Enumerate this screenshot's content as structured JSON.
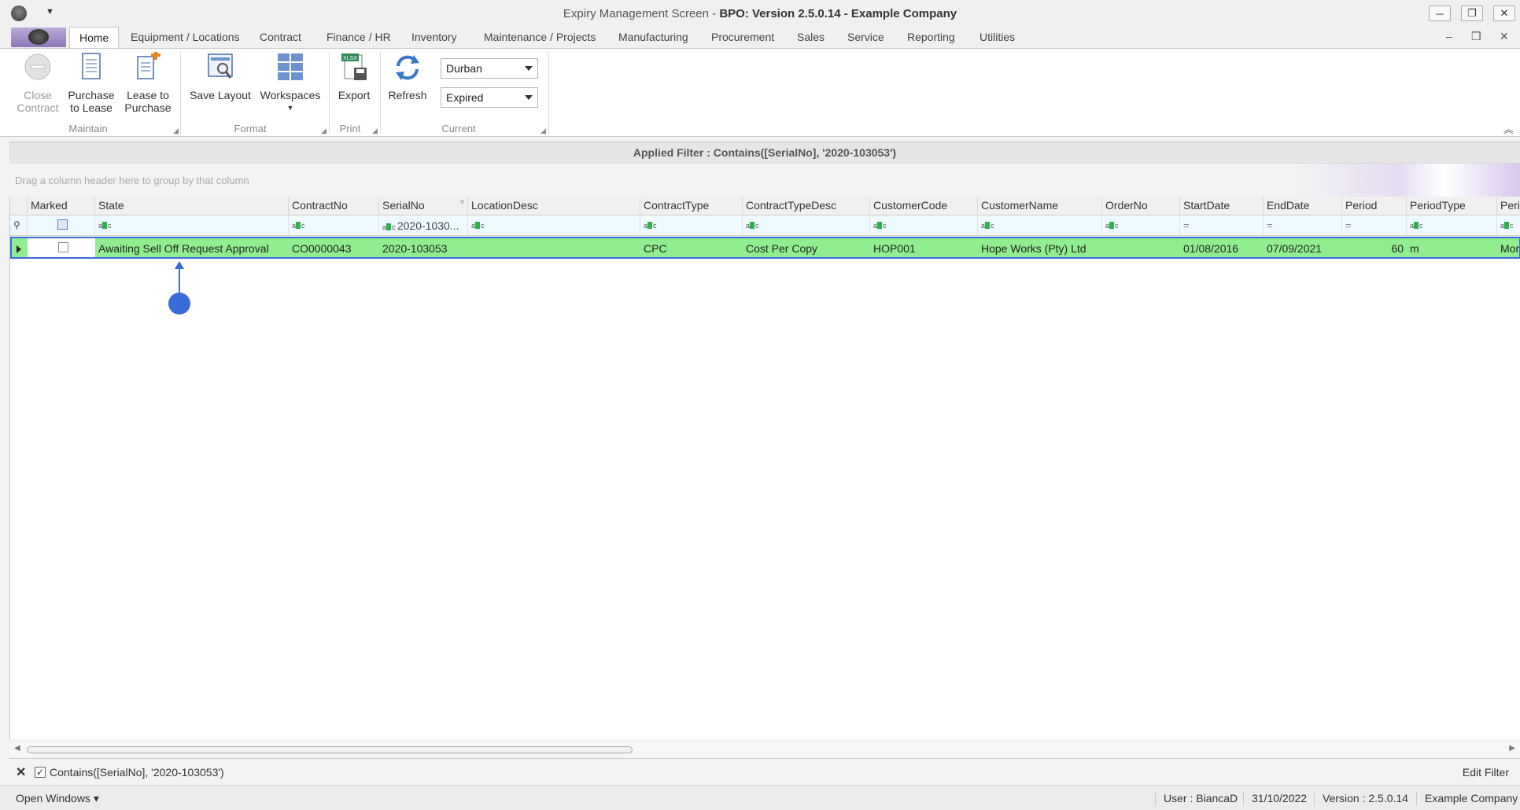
{
  "window": {
    "title_prefix": "Expiry Management Screen - ",
    "title_bold": "BPO: Version 2.5.0.14 - Example Company",
    "minimize": "─",
    "restore": "❐",
    "close": "✕"
  },
  "menu": {
    "tabs": [
      "Home",
      "Equipment / Locations",
      "Contract",
      "Finance / HR",
      "Inventory",
      "Maintenance / Projects",
      "Manufacturing",
      "Procurement",
      "Sales",
      "Service",
      "Reporting",
      "Utilities"
    ],
    "mdi_minimize": "–",
    "mdi_restore": "❐",
    "mdi_close": "✕"
  },
  "ribbon": {
    "close_contract": "Close Contract",
    "purchase_to_lease": "Purchase to Lease",
    "lease_to_purchase": "Lease to Purchase",
    "group_maintain": "Maintain",
    "save_layout": "Save Layout",
    "workspaces": "Workspaces",
    "group_format": "Format",
    "export": "Export",
    "group_print": "Print",
    "refresh": "Refresh",
    "location_value": "Durban",
    "status_value": "Expired",
    "group_current": "Current",
    "export_badge": "XLSX"
  },
  "grid": {
    "applied_filter": "Applied Filter : Contains([SerialNo], '2020-103053')",
    "group_panel_hint": "Drag a column header here to group by that column",
    "columns": [
      "Marked",
      "State",
      "ContractNo",
      "SerialNo",
      "LocationDesc",
      "ContractType",
      "ContractTypeDesc",
      "CustomerCode",
      "CustomerName",
      "OrderNo",
      "StartDate",
      "EndDate",
      "Period",
      "PeriodType",
      "Peri"
    ],
    "serial_filter": "2020-1030...",
    "row": {
      "state": "Awaiting Sell Off Request Approval",
      "contract_no": "CO0000043",
      "serial_no": "2020-103053",
      "location_desc": "",
      "contract_type": "CPC",
      "contract_type_desc": "Cost Per Copy",
      "customer_code": "HOP001",
      "customer_name": "Hope Works (Pty) Ltd",
      "order_no": "",
      "start_date": "01/08/2016",
      "end_date": "07/09/2021",
      "period": "60",
      "period_type": "m",
      "period_extra": "Mon"
    }
  },
  "filter_bar": {
    "filter_text": "Contains([SerialNo], '2020-103053')",
    "edit_filter": "Edit Filter"
  },
  "status_bar": {
    "open_windows": "Open Windows ▾",
    "user": "User : BiancaD",
    "date": "31/10/2022",
    "version": "Version : 2.5.0.14",
    "company": "Example Company"
  }
}
